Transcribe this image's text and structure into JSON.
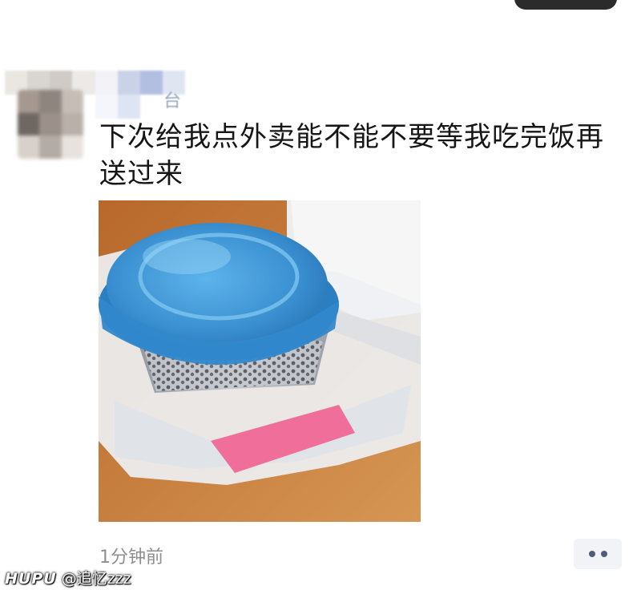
{
  "post": {
    "author_name_visible_char": "台",
    "message_line_1": "下次给我点外卖能不能不要等我吃完饭再",
    "message_line_2": "送过来",
    "timestamp": "1分钟前",
    "more_icon": "ellipsis-icon"
  },
  "watermark": {
    "brand": "HUPU",
    "handle": "@追忆zzz"
  },
  "colors": {
    "message_text": "#161616",
    "timestamp_text": "#8e8e8e",
    "more_button_bg": "#f2f3f7",
    "more_button_dots": "#4f5c7c",
    "lid_blue": "#3d95d6",
    "table_wood": "#c9833f"
  }
}
